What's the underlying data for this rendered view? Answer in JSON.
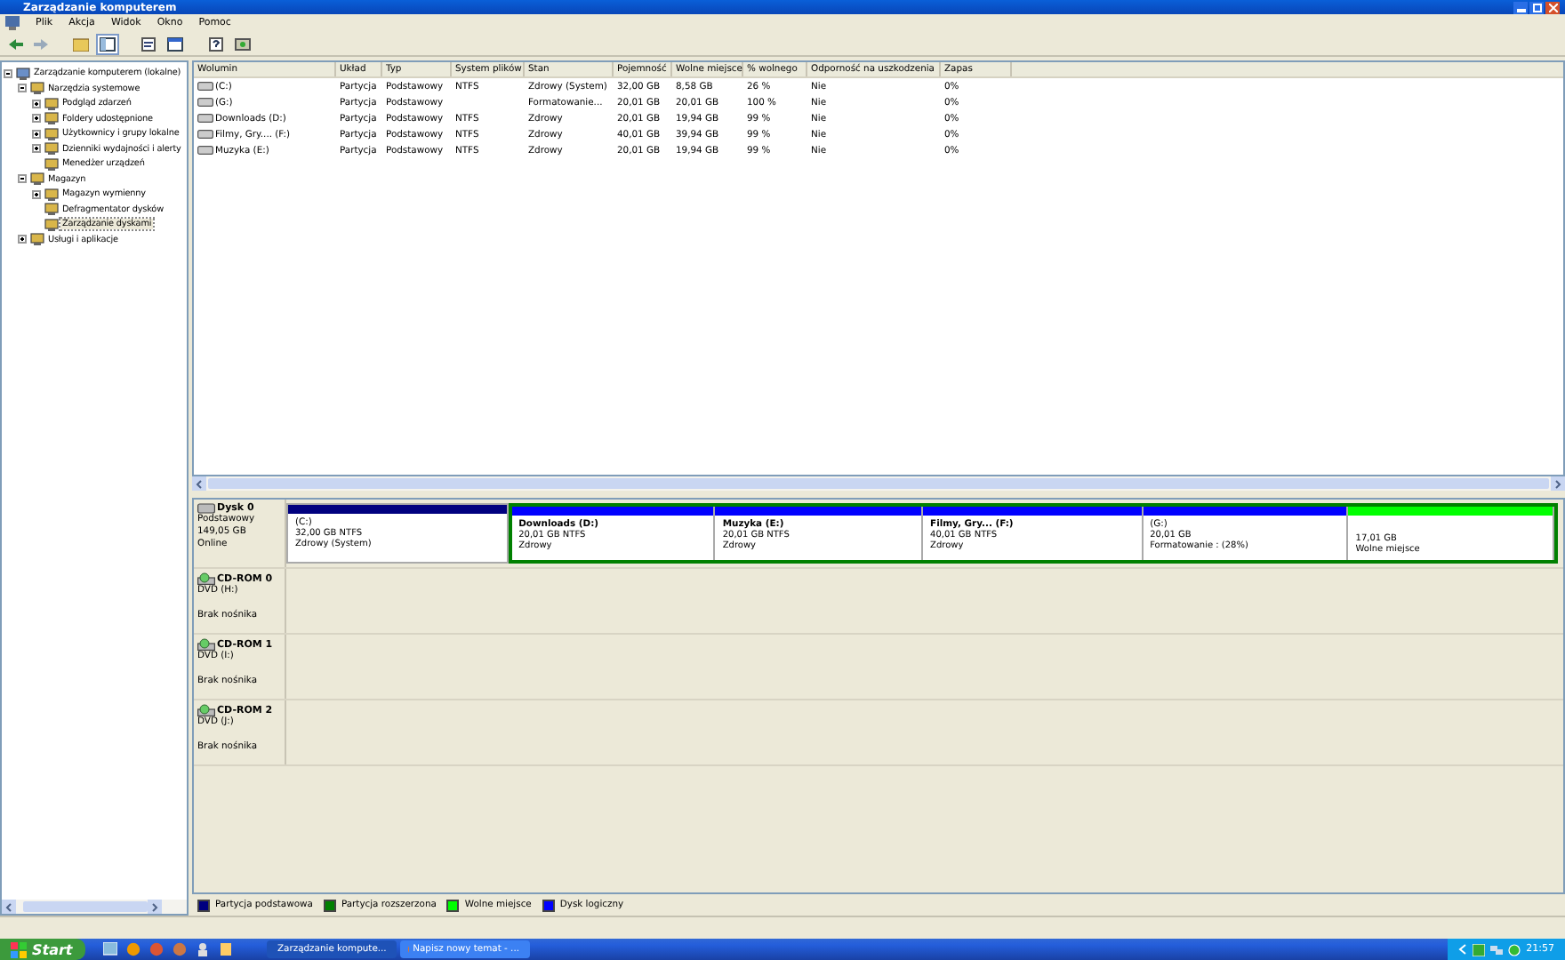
{
  "window": {
    "title": "Zarządzanie komputerem"
  },
  "menu": [
    "Plik",
    "Akcja",
    "Widok",
    "Okno",
    "Pomoc"
  ],
  "tree": [
    {
      "label": "Zarządzanie komputerem (lokalne)",
      "expanded": true,
      "selected": false,
      "children": [
        {
          "label": "Narzędzia systemowe",
          "expanded": true,
          "selected": false,
          "children": [
            {
              "label": "Podgląd zdarzeń",
              "expanded": false,
              "selected": false
            },
            {
              "label": "Foldery udostępnione",
              "expanded": false,
              "selected": false
            },
            {
              "label": "Użytkownicy i grupy lokalne",
              "expanded": false,
              "selected": false
            },
            {
              "label": "Dzienniki wydajności i alerty",
              "expanded": false,
              "selected": false
            },
            {
              "label": "Menedżer urządzeń",
              "selected": false
            }
          ]
        },
        {
          "label": "Magazyn",
          "expanded": true,
          "selected": false,
          "children": [
            {
              "label": "Magazyn wymienny",
              "expanded": false,
              "selected": false
            },
            {
              "label": "Defragmentator dysków",
              "selected": false
            },
            {
              "label": "Zarządzanie dyskami",
              "selected": true
            }
          ]
        },
        {
          "label": "Usługi i aplikacje",
          "expanded": false,
          "selected": false
        }
      ]
    }
  ],
  "table": {
    "columns": [
      "Wolumin",
      "Układ",
      "Typ",
      "System plików",
      "Stan",
      "Pojemność",
      "Wolne miejsce",
      "% wolnego",
      "Odporność na uszkodzenia",
      "Zapas"
    ],
    "rows": [
      [
        "(C:)",
        "Partycja",
        "Podstawowy",
        "NTFS",
        "Zdrowy (System)",
        "32,00 GB",
        "8,58 GB",
        "26 %",
        "Nie",
        "0%"
      ],
      [
        "(G:)",
        "Partycja",
        "Podstawowy",
        null,
        "Formatowanie...",
        "20,01 GB",
        "20,01 GB",
        "100 %",
        "Nie",
        "0%"
      ],
      [
        "Downloads (D:)",
        "Partycja",
        "Podstawowy",
        "NTFS",
        "Zdrowy",
        "20,01 GB",
        "19,94 GB",
        "99 %",
        "Nie",
        "0%"
      ],
      [
        "Filmy, Gry.... (F:)",
        "Partycja",
        "Podstawowy",
        "NTFS",
        "Zdrowy",
        "40,01 GB",
        "39,94 GB",
        "99 %",
        "Nie",
        "0%"
      ],
      [
        "Muzyka (E:)",
        "Partycja",
        "Podstawowy",
        "NTFS",
        "Zdrowy",
        "20,01 GB",
        "19,94 GB",
        "99 %",
        "Nie",
        "0%"
      ]
    ]
  },
  "disks": [
    {
      "kind": "disk",
      "name": "Dysk 0",
      "lines": [
        "Podstawowy",
        "149,05 GB",
        "Online"
      ],
      "partitions": [
        {
          "kind": "primary",
          "color": "#00007f",
          "title": "(C:)",
          "bold": false,
          "size": "32,00 GB NTFS",
          "status": "Zdrowy (System)"
        },
        {
          "kind": "extended",
          "color": "#008000",
          "partitions": [
            {
              "kind": "logical",
              "color": "#0000ff",
              "title": "Downloads  (D:)",
              "bold": true,
              "size": "20,01 GB NTFS",
              "status": "Zdrowy"
            },
            {
              "kind": "logical",
              "color": "#0000ff",
              "title": "Muzyka  (E:)",
              "bold": true,
              "size": "20,01 GB NTFS",
              "status": "Zdrowy"
            },
            {
              "kind": "logical",
              "color": "#0000ff",
              "title": "Filmy, Gry...  (F:)",
              "bold": true,
              "size": "40,01 GB NTFS",
              "status": "Zdrowy"
            },
            {
              "kind": "logical",
              "color": "#0000ff",
              "title": "(G:)",
              "bold": false,
              "size": "20,01 GB",
              "status": "Formatowanie : (28%)"
            },
            {
              "kind": "free",
              "color": "#00ff00",
              "size": "17,01 GB",
              "status": "Wolne miejsce"
            }
          ]
        }
      ]
    },
    {
      "kind": "cdrom",
      "name": "CD-ROM 0",
      "lines": [
        "DVD (H:)",
        "Brak nośnika"
      ]
    },
    {
      "kind": "cdrom",
      "name": "CD-ROM 1",
      "lines": [
        "DVD (I:)",
        "Brak nośnika"
      ]
    },
    {
      "kind": "cdrom",
      "name": "CD-ROM 2",
      "lines": [
        "DVD (J:)",
        "Brak nośnika"
      ]
    }
  ],
  "legend": [
    {
      "label": "Partycja podstawowa",
      "color": "#00007f"
    },
    {
      "label": "Partycja rozszerzona",
      "color": "#008000"
    },
    {
      "label": "Wolne miejsce",
      "color": "#00ff00"
    },
    {
      "label": "Dysk logiczny",
      "color": "#0000ff"
    }
  ],
  "taskbar": {
    "start": "Start",
    "tasks": [
      {
        "label": "Zarządzanie kompute...",
        "selected": true
      },
      {
        "label": "Napisz nowy temat - ...",
        "selected": false
      }
    ],
    "clock": "21:57"
  }
}
